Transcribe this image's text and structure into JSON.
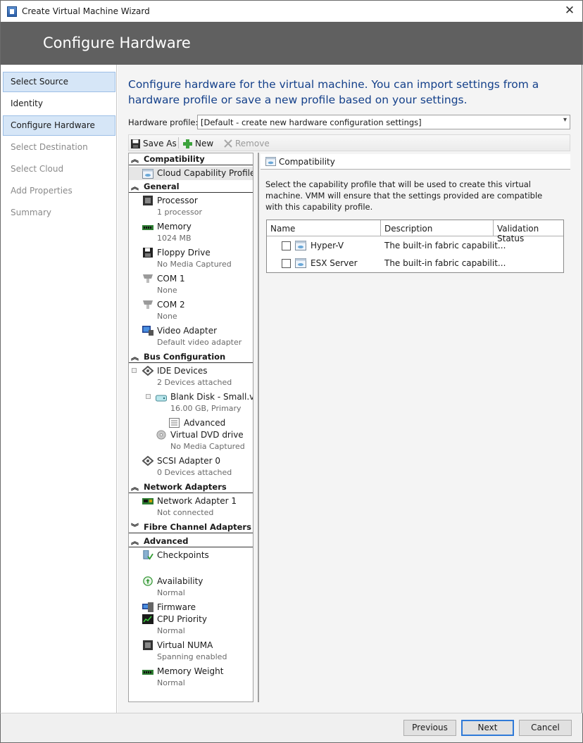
{
  "window": {
    "title": "Create Virtual Machine Wizard",
    "close_glyph": "✕"
  },
  "header": {
    "title": "Configure Hardware"
  },
  "nav": {
    "items": [
      {
        "label": "Select Source"
      },
      {
        "label": "Identity"
      },
      {
        "label": "Configure Hardware"
      },
      {
        "label": "Select Destination"
      },
      {
        "label": "Select Cloud"
      },
      {
        "label": "Add Properties"
      },
      {
        "label": "Summary"
      }
    ]
  },
  "main": {
    "description": "Configure hardware for the virtual machine. You can import settings from a hardware profile or save a new profile based on your settings.",
    "hardware_profile_label": "Hardware profile:",
    "hardware_profile_value": "[Default - create new hardware configuration settings]",
    "toolbar": {
      "save_as": "Save As",
      "new": "New",
      "remove": "Remove"
    }
  },
  "tree": {
    "sections": {
      "compatibility": "Compatibility",
      "general": "General",
      "bus": "Bus Configuration",
      "network": "Network Adapters",
      "fibre": "Fibre Channel Adapters",
      "advanced": "Advanced"
    },
    "items": {
      "cloud_capability": {
        "name": "Cloud Capability Profiles"
      },
      "processor": {
        "name": "Processor",
        "sub": "1 processor"
      },
      "memory": {
        "name": "Memory",
        "sub": "1024 MB"
      },
      "floppy": {
        "name": "Floppy Drive",
        "sub": "No Media Captured"
      },
      "com1": {
        "name": "COM 1",
        "sub": "None"
      },
      "com2": {
        "name": "COM 2",
        "sub": "None"
      },
      "video": {
        "name": "Video Adapter",
        "sub": "Default video adapter"
      },
      "ide": {
        "name": "IDE Devices",
        "sub": "2 Devices attached"
      },
      "blank_disk": {
        "name": "Blank Disk - Small.v...",
        "sub": "16.00 GB, Primary"
      },
      "disk_advanced": {
        "name": "Advanced"
      },
      "dvd": {
        "name": "Virtual DVD drive",
        "sub": "No Media Captured"
      },
      "scsi": {
        "name": "SCSI Adapter 0",
        "sub": "0 Devices attached"
      },
      "net1": {
        "name": "Network Adapter 1",
        "sub": "Not connected"
      },
      "checkpoints": {
        "name": "Checkpoints"
      },
      "availability": {
        "name": "Availability",
        "sub": "Normal"
      },
      "firmware": {
        "name": "Firmware"
      },
      "cpu_priority": {
        "name": "CPU Priority",
        "sub": "Normal"
      },
      "numa": {
        "name": "Virtual NUMA",
        "sub": "Spanning enabled"
      },
      "mem_weight": {
        "name": "Memory Weight",
        "sub": "Normal"
      }
    }
  },
  "right": {
    "title": "Compatibility",
    "text": "Select the capability profile that will be used to create this virtual machine. VMM will ensure that the settings provided are compatible with this capability profile.",
    "columns": [
      "Name",
      "Description",
      "Validation Status"
    ],
    "rows": [
      {
        "name": "Hyper-V",
        "description": "The built-in fabric capabilit..."
      },
      {
        "name": "ESX Server",
        "description": "The built-in fabric capabilit..."
      }
    ]
  },
  "footer": {
    "previous": "Previous",
    "next": "Next",
    "cancel": "Cancel"
  }
}
